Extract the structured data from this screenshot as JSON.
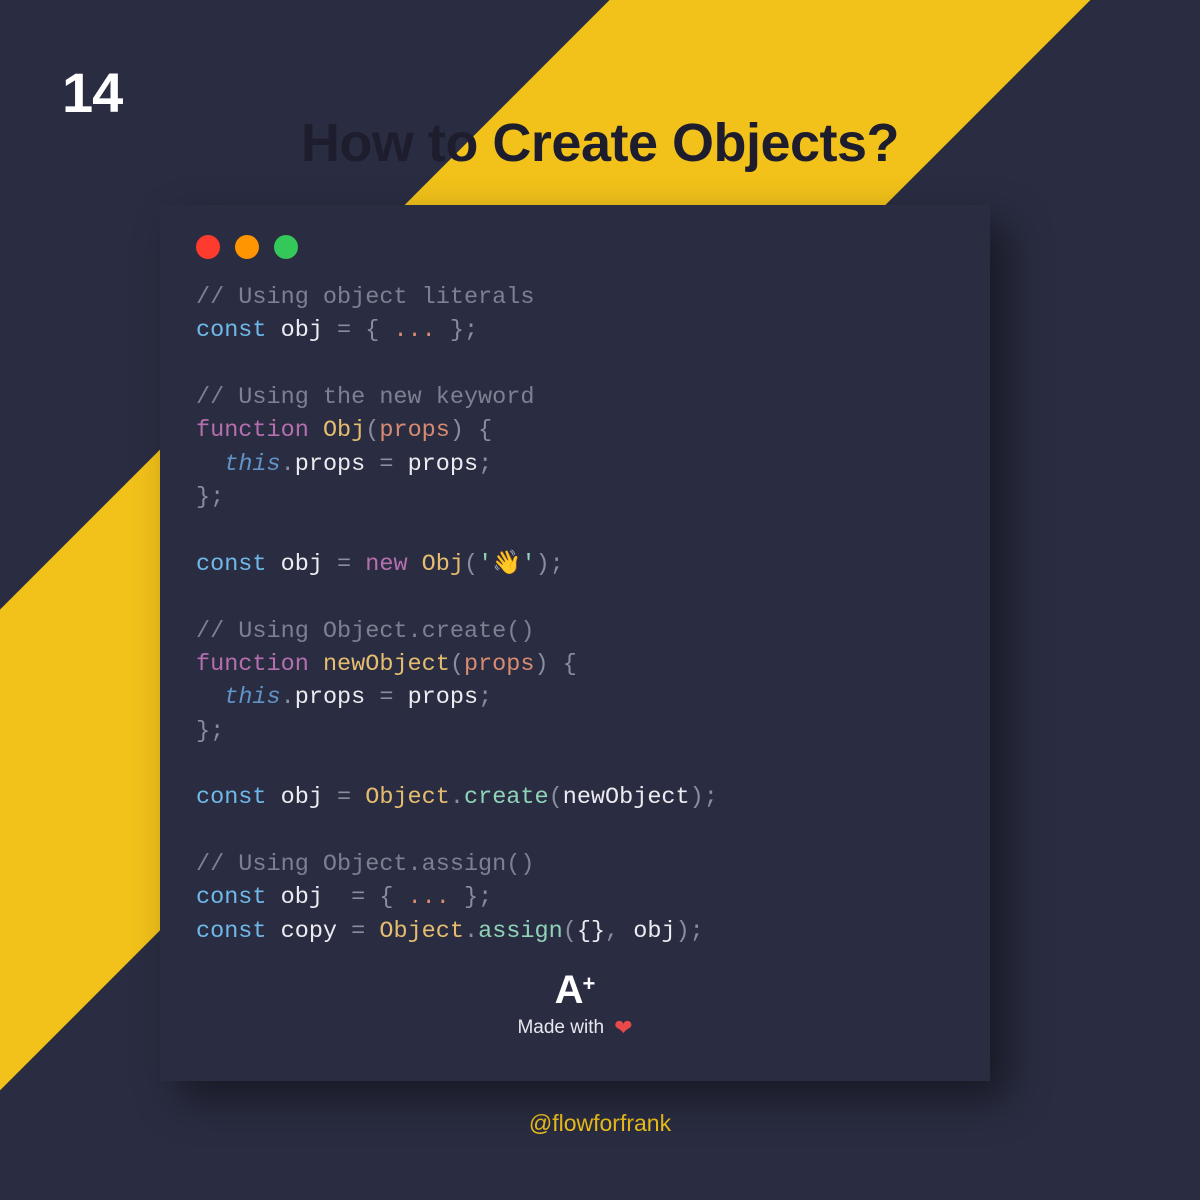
{
  "page_number": "14",
  "title": "How to Create Objects?",
  "code": {
    "c1": "// Using object literals",
    "l2_kw": "const",
    "l2_var": "obj",
    "l2_eq": " = { ",
    "l2_dots": "...",
    "l2_end": " };",
    "c2": "// Using the new keyword",
    "l4_kw": "function",
    "l4_name": "Obj",
    "l4_open": "(",
    "l4_param": "props",
    "l4_close": ")",
    "l4_brace": " {",
    "l5_this": "this",
    "l5_dot": ".",
    "l5_prop": "props",
    "l5_eq": " = ",
    "l5_val": "props",
    "l5_semi": ";",
    "l6_close": "};",
    "l7_kw": "const",
    "l7_var": "obj",
    "l7_eq": " = ",
    "l7_new": "new",
    "l7_sp": " ",
    "l7_class": "Obj",
    "l7_open": "(",
    "l7_str_open": "'",
    "l7_emoji": "👋",
    "l7_str_close": "'",
    "l7_close": ");",
    "c3": "// Using Object.create()",
    "l9_kw": "function",
    "l9_name": "newObject",
    "l9_open": "(",
    "l9_param": "props",
    "l9_close": ")",
    "l9_brace": " {",
    "l10_this": "this",
    "l10_dot": ".",
    "l10_prop": "props",
    "l10_eq": " = ",
    "l10_val": "props",
    "l10_semi": ";",
    "l11_close": "};",
    "l12_kw": "const",
    "l12_var": "obj",
    "l12_eq": " = ",
    "l12_obj": "Object",
    "l12_dot": ".",
    "l12_method": "create",
    "l12_open": "(",
    "l12_arg": "newObject",
    "l12_close": ");",
    "c4": "// Using Object.assign()",
    "l14_kw": "const",
    "l14_var": "obj ",
    "l14_eq": " = { ",
    "l14_dots": "...",
    "l14_end": " };",
    "l15_kw": "const",
    "l15_var": "copy",
    "l15_eq": " = ",
    "l15_obj": "Object",
    "l15_dot": ".",
    "l15_method": "assign",
    "l15_open": "(",
    "l15_arg1": "{}",
    "l15_comma": ", ",
    "l15_arg2": "obj",
    "l15_close": ");"
  },
  "footer": {
    "logo_a": "A",
    "logo_plus": "+",
    "made_with": "Made with",
    "heart": "❤"
  },
  "handle": "@flowforfrank"
}
